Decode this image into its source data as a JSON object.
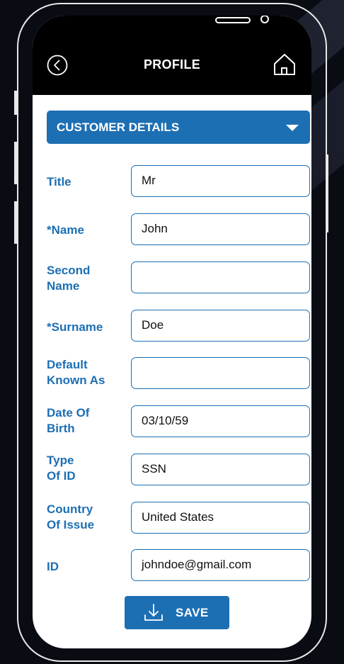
{
  "header": {
    "title": "PROFILE"
  },
  "section": {
    "label": "CUSTOMER DETAILS"
  },
  "form": {
    "title": {
      "label": "Title",
      "value": "Mr"
    },
    "name": {
      "label": "*Name",
      "value": "John"
    },
    "second_name": {
      "label1": "Second",
      "label2": "Name",
      "value": ""
    },
    "surname": {
      "label": "*Surname",
      "value": "Doe"
    },
    "known_as": {
      "label1": "Default",
      "label2": "Known As",
      "value": ""
    },
    "dob": {
      "label1": "Date Of",
      "label2": "Birth",
      "value": "03/10/59"
    },
    "id_type": {
      "label1": "Type",
      "label2": "Of ID",
      "value": "SSN"
    },
    "country": {
      "label1": "Country",
      "label2": "Of Issue",
      "value": "United States"
    },
    "id": {
      "label": "ID",
      "value": "johndoe@gmail.com"
    }
  },
  "actions": {
    "save": "SAVE"
  },
  "colors": {
    "accent": "#1d6fb3",
    "header": "#000000",
    "frame": "#e8e8e8"
  },
  "icons": {
    "back": "chevron-left-circle-icon",
    "home": "home-icon",
    "save": "download-icon",
    "section": "caret-down-icon"
  }
}
